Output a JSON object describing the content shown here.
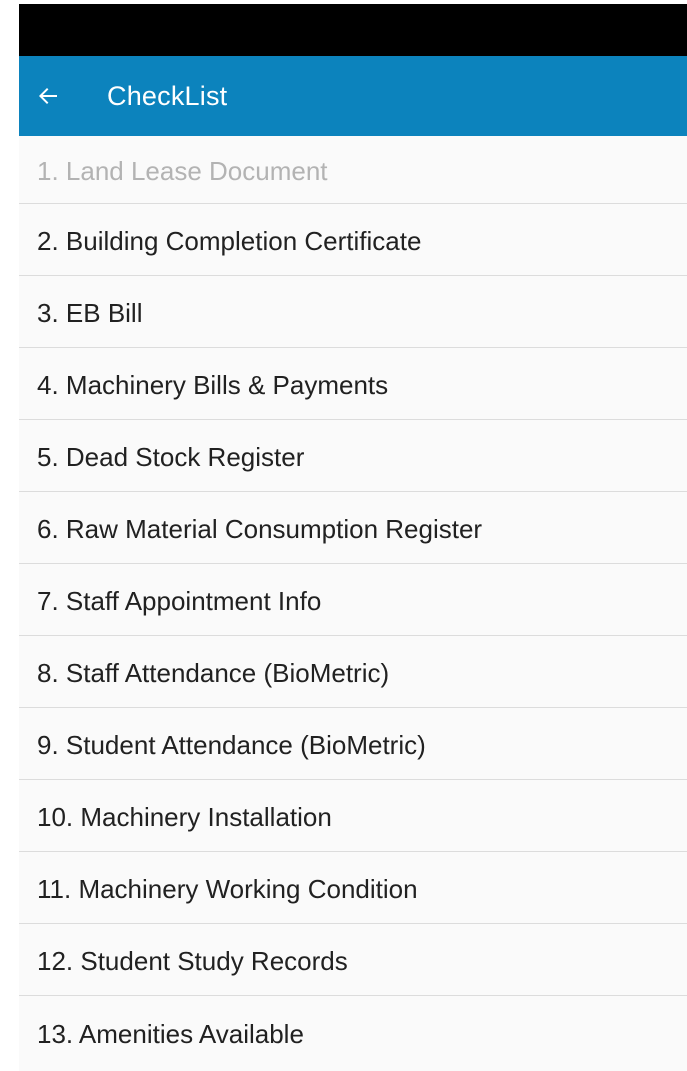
{
  "app_bar": {
    "title": "CheckList",
    "background_color": "#0c83bd",
    "back_icon": "arrow-left-icon"
  },
  "status_bar": {
    "background_color": "#000000"
  },
  "checklist": {
    "items": [
      {
        "label": "1. Land Lease Document",
        "enabled": false
      },
      {
        "label": "2. Building Completion Certificate",
        "enabled": true
      },
      {
        "label": "3. EB Bill",
        "enabled": true
      },
      {
        "label": "4. Machinery Bills & Payments",
        "enabled": true
      },
      {
        "label": "5. Dead Stock Register",
        "enabled": true
      },
      {
        "label": "6. Raw Material Consumption Register",
        "enabled": true
      },
      {
        "label": "7. Staff Appointment Info",
        "enabled": true
      },
      {
        "label": "8. Staff Attendance (BioMetric)",
        "enabled": true
      },
      {
        "label": "9. Student Attendance (BioMetric)",
        "enabled": true
      },
      {
        "label": "10. Machinery Installation",
        "enabled": true
      },
      {
        "label": "11. Machinery Working Condition",
        "enabled": true
      },
      {
        "label": "12. Student Study Records",
        "enabled": true
      },
      {
        "label": "13. Amenities Available",
        "enabled": true
      }
    ]
  }
}
